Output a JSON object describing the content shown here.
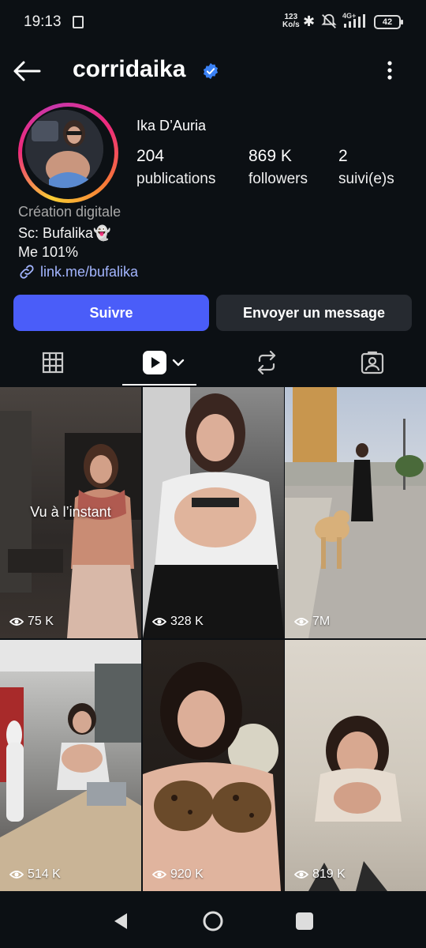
{
  "status_bar": {
    "time": "19:13",
    "net_speed_value": "123",
    "net_speed_unit": "Ko/s",
    "network": "4G+",
    "battery": "42"
  },
  "profile": {
    "username": "corridaika",
    "full_name": "Ika D’Auria",
    "stats": [
      {
        "value": "204",
        "label": "publications"
      },
      {
        "value": "869 K",
        "label": "followers"
      },
      {
        "value": "2",
        "label": "suivi(e)s"
      }
    ],
    "category": "Création digitale",
    "bio_line1": "Sc: Bufalika👻",
    "bio_line2": "Me 101%",
    "link": "link.me/bufalika"
  },
  "actions": {
    "follow": "Suivre",
    "message": "Envoyer un message"
  },
  "tabs": [
    "grid",
    "reels",
    "reposts",
    "tagged"
  ],
  "reels": [
    {
      "views": "75 K",
      "overlay": "Vu à l’instant"
    },
    {
      "views": "328 K"
    },
    {
      "views": "7M"
    },
    {
      "views": "514 K"
    },
    {
      "views": "920 K"
    },
    {
      "views": "819 K"
    }
  ],
  "colors": {
    "background": "#0c1014",
    "follow_button": "#4a5df9",
    "link": "#a3b5ff",
    "verified": "#3b82f6"
  }
}
